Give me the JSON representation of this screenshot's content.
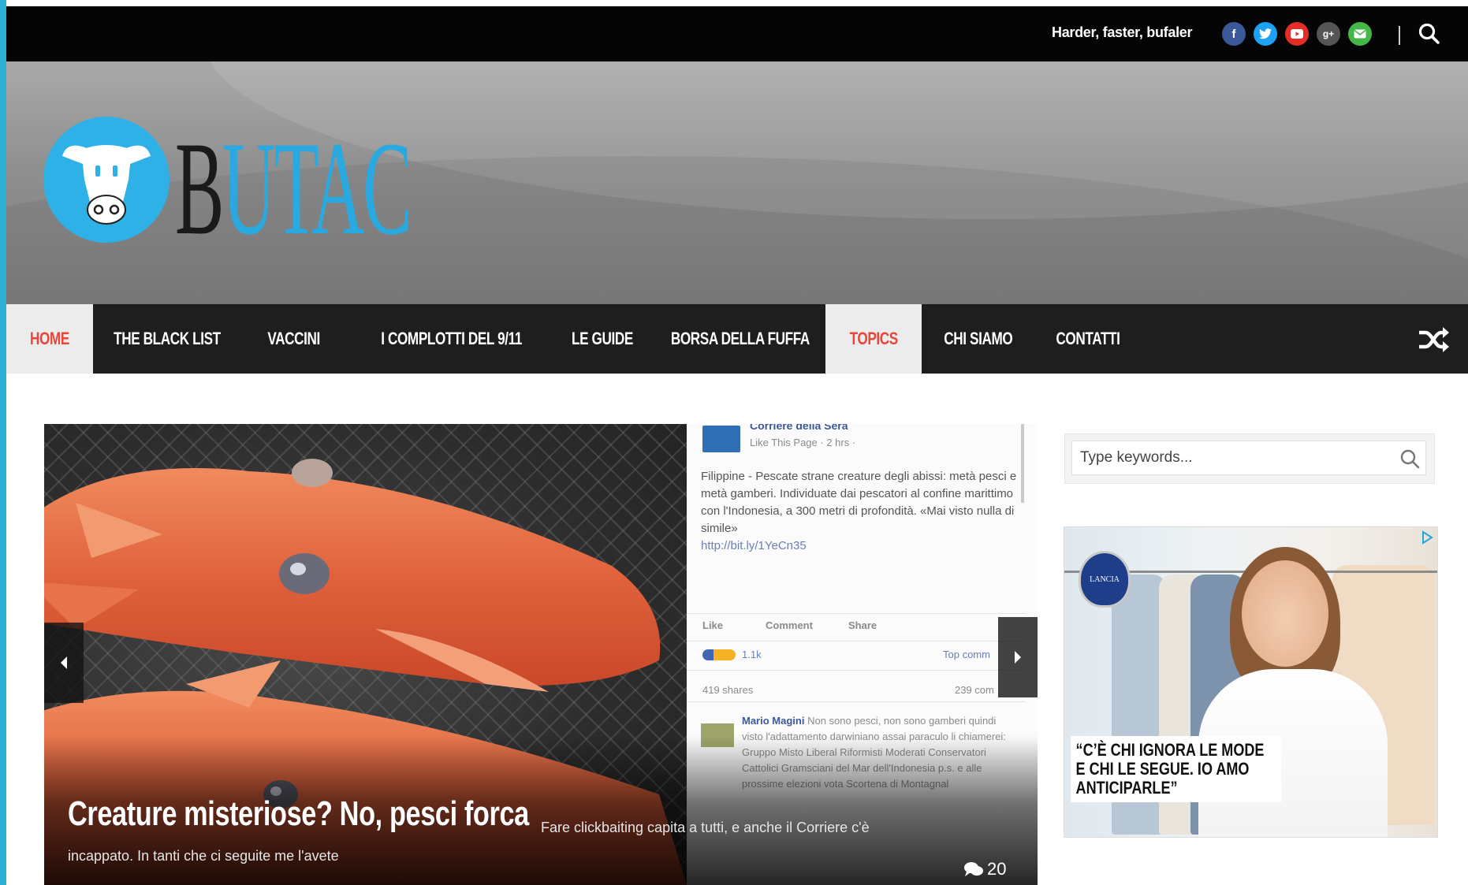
{
  "topbar": {
    "tagline": "Harder, faster, bufaler",
    "social": [
      {
        "name": "facebook-icon",
        "color": "#3b5998",
        "glyph": "f"
      },
      {
        "name": "twitter-icon",
        "color": "#1da1f2",
        "glyph": ""
      },
      {
        "name": "youtube-icon",
        "color": "#e52d27",
        "glyph": ""
      },
      {
        "name": "google-plus-icon",
        "color": "#555555",
        "glyph": "g+"
      },
      {
        "name": "email-icon",
        "color": "#47b649",
        "glyph": ""
      }
    ]
  },
  "logo": {
    "letter_b": "B",
    "letters_rest": "UTAC"
  },
  "nav": {
    "items": [
      {
        "label": "HOME",
        "active": true
      },
      {
        "label": "THE BLACK LIST",
        "active": false
      },
      {
        "label": "VACCINI",
        "active": false
      },
      {
        "label": "I COMPLOTTI DEL 9/11",
        "active": false
      },
      {
        "label": "LE GUIDE",
        "active": false
      },
      {
        "label": "BORSA DELLA FUFFA",
        "active": false
      },
      {
        "label": "TOPICS",
        "active": true
      },
      {
        "label": "CHI SIAMO",
        "active": false
      },
      {
        "label": "CONTATTI",
        "active": false
      }
    ]
  },
  "slider": {
    "title": "Creature misteriose? No, pesci forca",
    "desc_line1": "Fare clickbaiting capita a tutti, e anche il Corriere c'è",
    "desc_line2": "incappato. In tanti che ci seguite me l'avete",
    "comment_count": "20",
    "fb": {
      "page_name": "Corriere della Sera",
      "meta": "Like This Page · 2 hrs · ",
      "post": "Filippine - Pescate strane creature degli abissi: metà pesci e metà gamberi. Individuate dai pescatori al confine marittimo con l'Indonesia, a 300 metri di profondità. «Mai visto nulla di simile»",
      "link": "http://bit.ly/1YeCn35",
      "like": "Like",
      "comment": "Comment",
      "share": "Share",
      "reactions": "1.1k",
      "top_comments": "Top comm",
      "shares": "419 shares",
      "comments_count": "239 com",
      "commenter": "Mario Magini",
      "comment_text": "Non sono pesci, non sono gamberi quindi visto l'adattamento darwiniano assai paraculo li chiamerei: Gruppo Misto Liberal Riformisti Moderati Conservatori Cattolici Gramsciani del Mar dell'Indonesia  p.s. e alle prossime elezioni vota Scortena di Montagnal"
    }
  },
  "sidebar": {
    "search_placeholder": "Type keywords...",
    "ad": {
      "brand": "LANCIA",
      "quote": "“C’È CHI IGNORA LE MODE E CHI LE SEGUE. IO AMO ANTICIPARLE”"
    }
  }
}
